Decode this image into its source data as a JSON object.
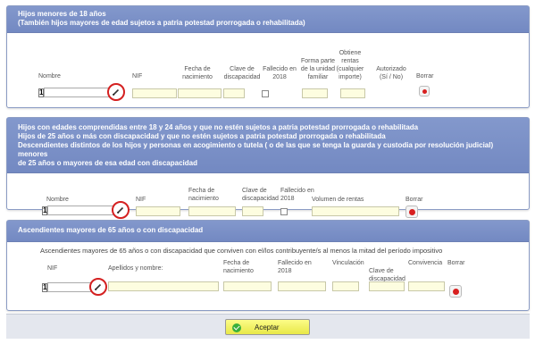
{
  "section1": {
    "title_line1": "Hijos menores de 18 años",
    "title_line2": "(También hijos mayores de edad sujetos a patria potestad prorrogada o rehabilitada)",
    "col_nombre": "Nombre",
    "col_nif": "NIF",
    "col_fecha_line1": "Fecha de",
    "col_fecha_line2": "nacimiento",
    "col_clave_line1": "Clave de",
    "col_clave_line2": "discapacidad",
    "col_fallecido_line1": "Fallecido en",
    "col_fallecido_line2": "2018",
    "col_forma_line1": "Forma parte",
    "col_forma_line2": "de la unidad",
    "col_forma_line3": "familiar",
    "col_obtiene_line1": "Obtiene",
    "col_obtiene_line2": "rentas",
    "col_obtiene_line3": "(cualquier",
    "col_obtiene_line4": "importe)",
    "col_autorizado_line1": "Autorizado",
    "col_autorizado_line2": "(Sí / No)",
    "col_borrar": "Borrar",
    "row_index": "1"
  },
  "section2": {
    "title_line1": "Hijos con edades comprendidas entre 18 y 24 años y que no estén sujetos a patria potestad prorrogada o rehabilitada",
    "title_line2": "Hijos de 25 años o más con discapacidad y que no estén sujetos a patria potestad prorrogada o rehabilitada",
    "title_line3": "Descendientes distintos de los hijos y personas en acogimiento o tutela ( o de las que se tenga la guarda y custodia por resolución judicial) menores",
    "title_line4": "de 25 años o mayores de esa edad con discapacidad",
    "col_nombre": "Nombre",
    "col_nif": "NIF",
    "col_fecha_line1": "Fecha de",
    "col_fecha_line2": "nacimiento",
    "col_clave_line1": "Clave de",
    "col_clave_line2": "discapacidad",
    "col_fallecido_line1": "Fallecido en",
    "col_fallecido_line2": "2018",
    "col_volumen": "Volumen de rentas",
    "col_borrar": "Borrar",
    "row_index": "1"
  },
  "section3": {
    "title": "Ascendientes mayores de 65 años o con discapacidad",
    "note": "Ascendientes mayores de 65 años o con discapacidad que conviven con el/los contribuyente/s al menos la mitad del período impositivo",
    "col_nif": "NIF",
    "col_apellidos": "Apellidos y nombre:",
    "col_fecha_line1": "Fecha de",
    "col_fecha_line2": "nacimiento",
    "col_fallecido_line1": "Fallecido en",
    "col_fallecido_line2": "2018",
    "col_vinculacion": "Vinculación",
    "col_clave_line1": "Clave de",
    "col_clave_line2": "discapacidad",
    "col_convivencia": "Convivencia",
    "col_borrar": "Borrar",
    "row_index": "1"
  },
  "footer": {
    "accept_label": "Aceptar"
  }
}
